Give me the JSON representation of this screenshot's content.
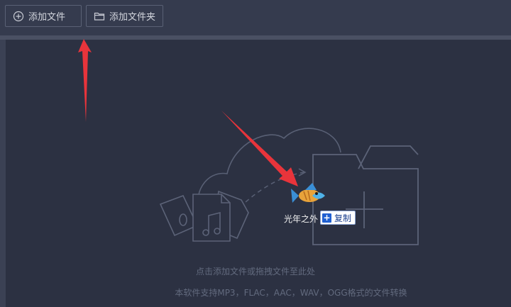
{
  "toolbar": {
    "add_file_label": "添加文件",
    "add_folder_label": "添加文件夹"
  },
  "drop_zone": {
    "drag_item_label": "光年之外",
    "drag_action_label": "复制",
    "hint_primary": "点击添加文件或拖拽文件至此处",
    "hint_secondary": "本软件支持MP3，FLAC，AAC，WAV，OGG格式的文件转换"
  },
  "colors": {
    "background": "#2c3142",
    "toolbar": "#353b4e",
    "illustration_stroke": "#5c6378",
    "arrow_annotation": "#e8343b"
  },
  "icons": [
    "plus-circle-icon",
    "folder-icon",
    "cloud-icon",
    "music-file-icon",
    "microphone-file-icon",
    "folder-plus-icon",
    "fish-icon"
  ]
}
